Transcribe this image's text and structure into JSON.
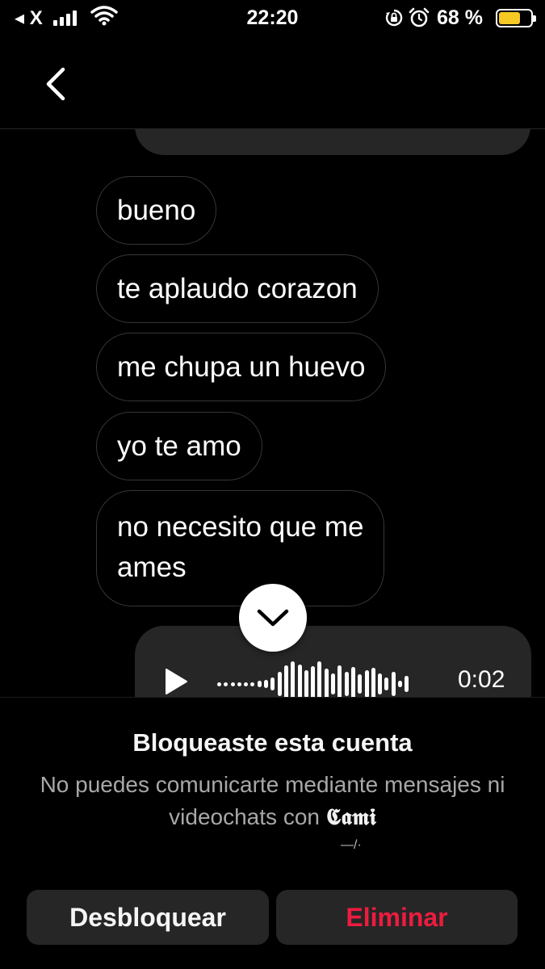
{
  "status_bar": {
    "back_app": "◂ X",
    "time": "22:20",
    "battery_text": "68 %",
    "battery_level": 0.68,
    "battery_color": "#f7c925",
    "icons": [
      "signal-icon",
      "wifi-icon",
      "orientation-lock-icon",
      "alarm-icon",
      "battery-icon"
    ]
  },
  "header": {
    "back_icon": "chevron-left-icon",
    "contact_name": ""
  },
  "messages": [
    {
      "direction": "outgoing",
      "type": "text",
      "text": ""
    },
    {
      "direction": "incoming",
      "type": "text",
      "text": "bueno"
    },
    {
      "direction": "incoming",
      "type": "text",
      "text": "te aplaudo corazon"
    },
    {
      "direction": "incoming",
      "type": "text",
      "text": "me chupa un huevo"
    },
    {
      "direction": "incoming",
      "type": "text",
      "text": "yo te amo"
    },
    {
      "direction": "incoming",
      "type": "text",
      "text": "no necesito que me\names"
    },
    {
      "direction": "outgoing",
      "type": "audio",
      "duration": "0:02",
      "icon": "play-icon"
    }
  ],
  "scroll_down": {
    "icon": "chevron-down-icon"
  },
  "blocked": {
    "title": "Bloqueaste esta cuenta",
    "description": "No puedes comunicarte mediante mensajes ni videochats con",
    "contact_name": "𝕮𝖆𝖒𝖎",
    "extra": "—/·",
    "unblock_label": "Desbloquear",
    "delete_label": "Eliminar",
    "delete_color": "#ed1c3f"
  }
}
